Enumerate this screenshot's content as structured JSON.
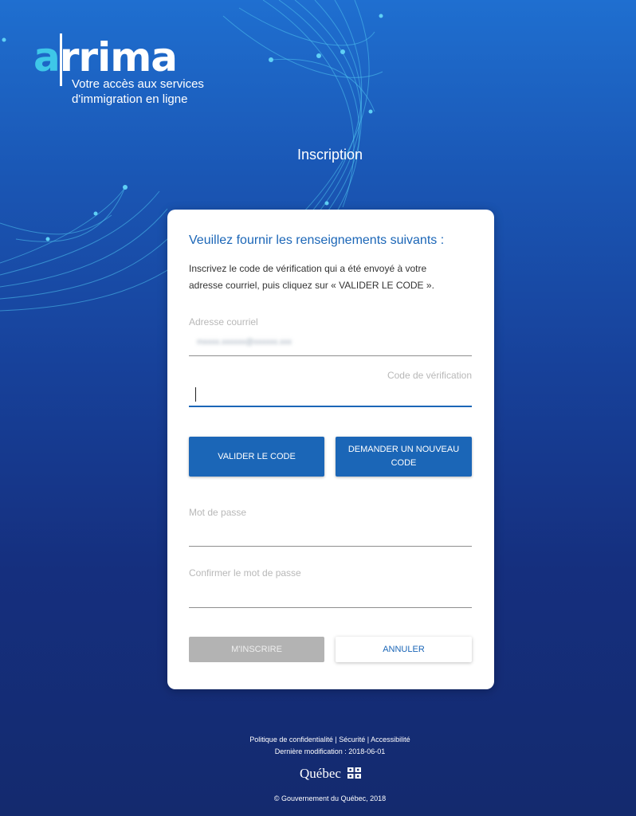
{
  "logo": {
    "text_a": "a",
    "text_rest": "rrima",
    "tagline_line1": "Votre accès aux services",
    "tagline_line2": "d'immigration en ligne"
  },
  "page_title": "Inscription",
  "form": {
    "heading": "Veuillez fournir les renseignements suivants :",
    "intro": "Inscrivez le code de vérification qui a été envoyé à votre adresse courriel, puis cliquez sur « VALIDER LE CODE ».",
    "email_label": "Adresse courriel",
    "email_value": "mxxxx.xxxxxx@xxxxxx.xxx",
    "code_label": "Code de vérification",
    "code_value": "",
    "password_label": "Mot de passe",
    "confirm_label": "Confirmer le mot de passe",
    "validate_button": "VALIDER LE CODE",
    "new_code_button": "DEMANDER UN NOUVEAU CODE",
    "register_button": "M'INSCRIRE",
    "cancel_button": "ANNULER"
  },
  "footer": {
    "privacy": "Politique de confidentialité",
    "security": "Sécurité",
    "accessibility": "Accessibilité",
    "separator": "|",
    "last_modified": "Dernière modification : 2018-06-01",
    "quebec_logo_text": "Québec",
    "copyright": "© Gouvernement du Québec, 2018"
  },
  "colors": {
    "accent": "#1b66b7",
    "logo_accent": "#3ec7e8",
    "background_top": "#1f6fd0",
    "background_bottom": "#142a6e"
  }
}
